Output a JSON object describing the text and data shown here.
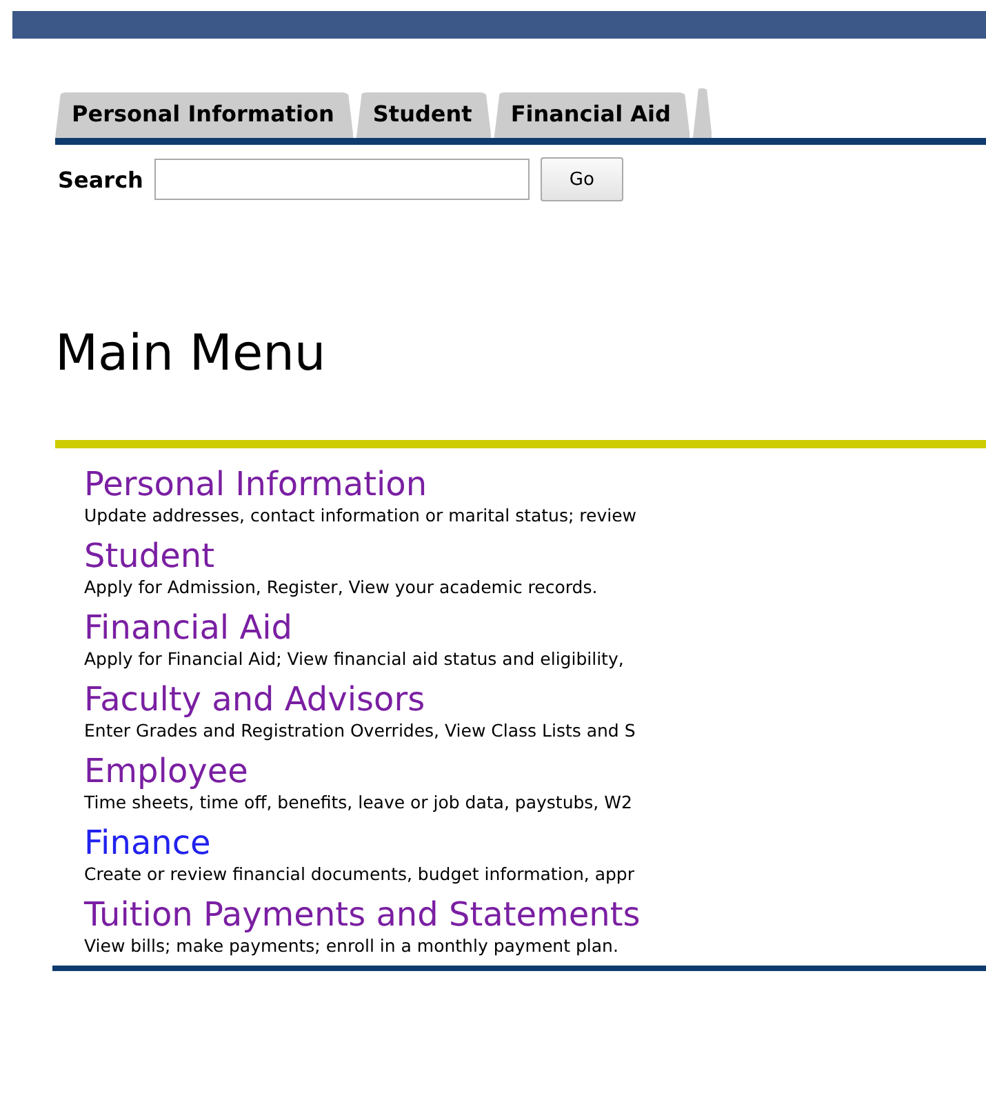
{
  "tabs": [
    {
      "label": "Personal Information"
    },
    {
      "label": "Student"
    },
    {
      "label": "Financial Aid"
    }
  ],
  "search": {
    "label": "Search",
    "button": "Go"
  },
  "title": "Main Menu",
  "menu": [
    {
      "title": "Personal Information",
      "visited": true,
      "description": "Update addresses, contact information or marital status; review"
    },
    {
      "title": "Student",
      "visited": true,
      "description": "Apply for Admission, Register, View your academic records."
    },
    {
      "title": "Financial Aid",
      "visited": true,
      "description": "Apply for Financial Aid; View financial aid status and eligibility,"
    },
    {
      "title": "Faculty and Advisors",
      "visited": true,
      "description": "Enter Grades and Registration Overrides, View Class Lists and S"
    },
    {
      "title": "Employee",
      "visited": true,
      "description": "Time sheets, time off, benefits, leave or job data, paystubs, W2"
    },
    {
      "title": "Finance",
      "visited": false,
      "description": "Create or review financial documents, budget information, appr"
    },
    {
      "title": "Tuition Payments and Statements",
      "visited": true,
      "description": "View bills; make payments; enroll in a monthly payment plan."
    }
  ]
}
